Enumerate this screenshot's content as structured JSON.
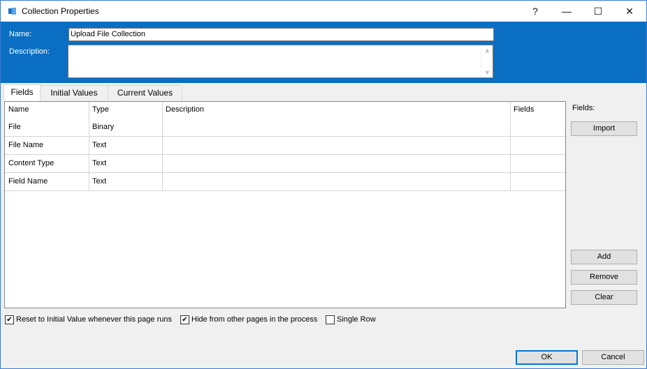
{
  "window": {
    "title": "Collection Properties",
    "help": "?",
    "minimize": "—",
    "maximize": "☐",
    "close": "✕"
  },
  "header": {
    "name_label": "Name:",
    "name_value": "Upload File Collection",
    "description_label": "Description:",
    "description_value": ""
  },
  "tabs": [
    {
      "label": "Fields"
    },
    {
      "label": "Initial Values"
    },
    {
      "label": "Current Values"
    }
  ],
  "grid": {
    "columns": [
      "Name",
      "Type",
      "Description",
      "Fields"
    ],
    "rows": [
      [
        "File",
        "Binary",
        "",
        ""
      ],
      [
        "File Name",
        "Text",
        "",
        ""
      ],
      [
        "Content Type",
        "Text",
        "",
        ""
      ],
      [
        "Field Name",
        "Text",
        "",
        ""
      ]
    ]
  },
  "side": {
    "fields_label": "Fields:",
    "import": "Import",
    "add": "Add",
    "remove": "Remove",
    "clear": "Clear"
  },
  "options": {
    "reset_label": "Reset to Initial Value whenever this page runs",
    "reset_checked": true,
    "hide_label": "Hide from other pages in the process",
    "hide_checked": true,
    "single_label": "Single Row",
    "single_checked": false
  },
  "footer": {
    "ok": "OK",
    "cancel": "Cancel"
  },
  "colors": {
    "header_blue": "#0a6fc2",
    "focus_blue": "#0078d7"
  }
}
